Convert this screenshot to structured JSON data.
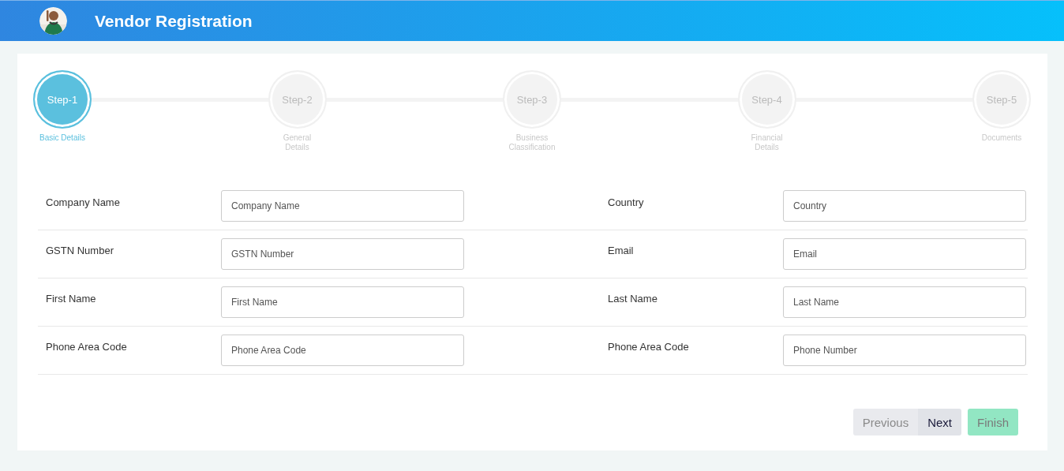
{
  "header": {
    "title": "Vendor Registration"
  },
  "steps": [
    {
      "label": "Step-1",
      "caption": "Basic Details",
      "selected": true
    },
    {
      "label": "Step-2",
      "caption": "General\nDetails",
      "selected": false
    },
    {
      "label": "Step-3",
      "caption": "Business\nClassification",
      "selected": false
    },
    {
      "label": "Step-4",
      "caption": "Financial\nDetails",
      "selected": false
    },
    {
      "label": "Step-5",
      "caption": "Documents",
      "selected": false
    }
  ],
  "rows": [
    [
      {
        "label": "Company Name",
        "placeholder": "Company Name"
      },
      {
        "label": "Country",
        "placeholder": "Country"
      }
    ],
    [
      {
        "label": "GSTN Number",
        "placeholder": "GSTN Number"
      },
      {
        "label": "Email",
        "placeholder": "Email"
      }
    ],
    [
      {
        "label": "First Name",
        "placeholder": "First Name"
      },
      {
        "label": "Last Name",
        "placeholder": "Last Name"
      }
    ],
    [
      {
        "label": "Phone Area Code",
        "placeholder": "Phone Area Code"
      },
      {
        "label": "Phone Area Code",
        "placeholder": "Phone Number"
      }
    ]
  ],
  "buttons": [
    {
      "label": "Previous",
      "kind": "pager",
      "disabled": true
    },
    {
      "label": "Next",
      "kind": "pager",
      "disabled": false
    },
    {
      "label": "Finish",
      "kind": "finish",
      "disabled": true
    }
  ]
}
